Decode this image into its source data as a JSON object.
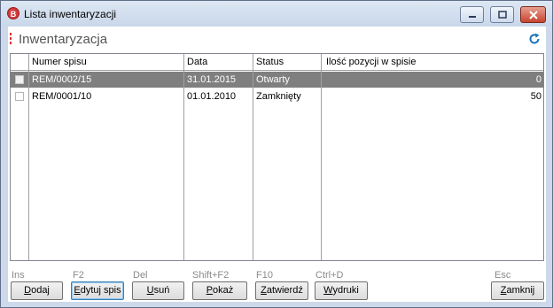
{
  "window": {
    "title": "Lista inwentaryzacji",
    "icon_letter": "B"
  },
  "header": {
    "title": "Inwentaryzacja"
  },
  "table": {
    "columns": [
      "Numer spisu",
      "Data",
      "Status",
      "Ilość pozycji w spisie"
    ],
    "rows": [
      {
        "numer": "REM/0002/15",
        "data": "31.01.2015",
        "status": "Otwarty",
        "ilosc": "0",
        "selected": true
      },
      {
        "numer": "REM/0001/10",
        "data": "01.01.2010",
        "status": "Zamknięty",
        "ilosc": "50",
        "selected": false
      }
    ]
  },
  "toolbar": {
    "shortcuts": {
      "add": "Ins",
      "edit": "F2",
      "delete": "Del",
      "show": "Shift+F2",
      "approve": "F10",
      "print": "Ctrl+D",
      "close": "Esc"
    },
    "buttons": {
      "add_u": "D",
      "add_rest": "odaj",
      "edit_u": "E",
      "edit_rest": "dytuj spis",
      "delete_u": "U",
      "delete_rest": "suń",
      "show_u": "P",
      "show_rest": "okaż",
      "approve_u": "Z",
      "approve_rest": "atwierdź",
      "print_u": "W",
      "print_rest": "ydruki",
      "close_u": "Z",
      "close_rest": "amknij"
    }
  },
  "colors": {
    "selection": "#7f7f7f",
    "title_bar": "#c9d7ea",
    "close_button": "#c7452e",
    "accent": "#1e73be"
  }
}
